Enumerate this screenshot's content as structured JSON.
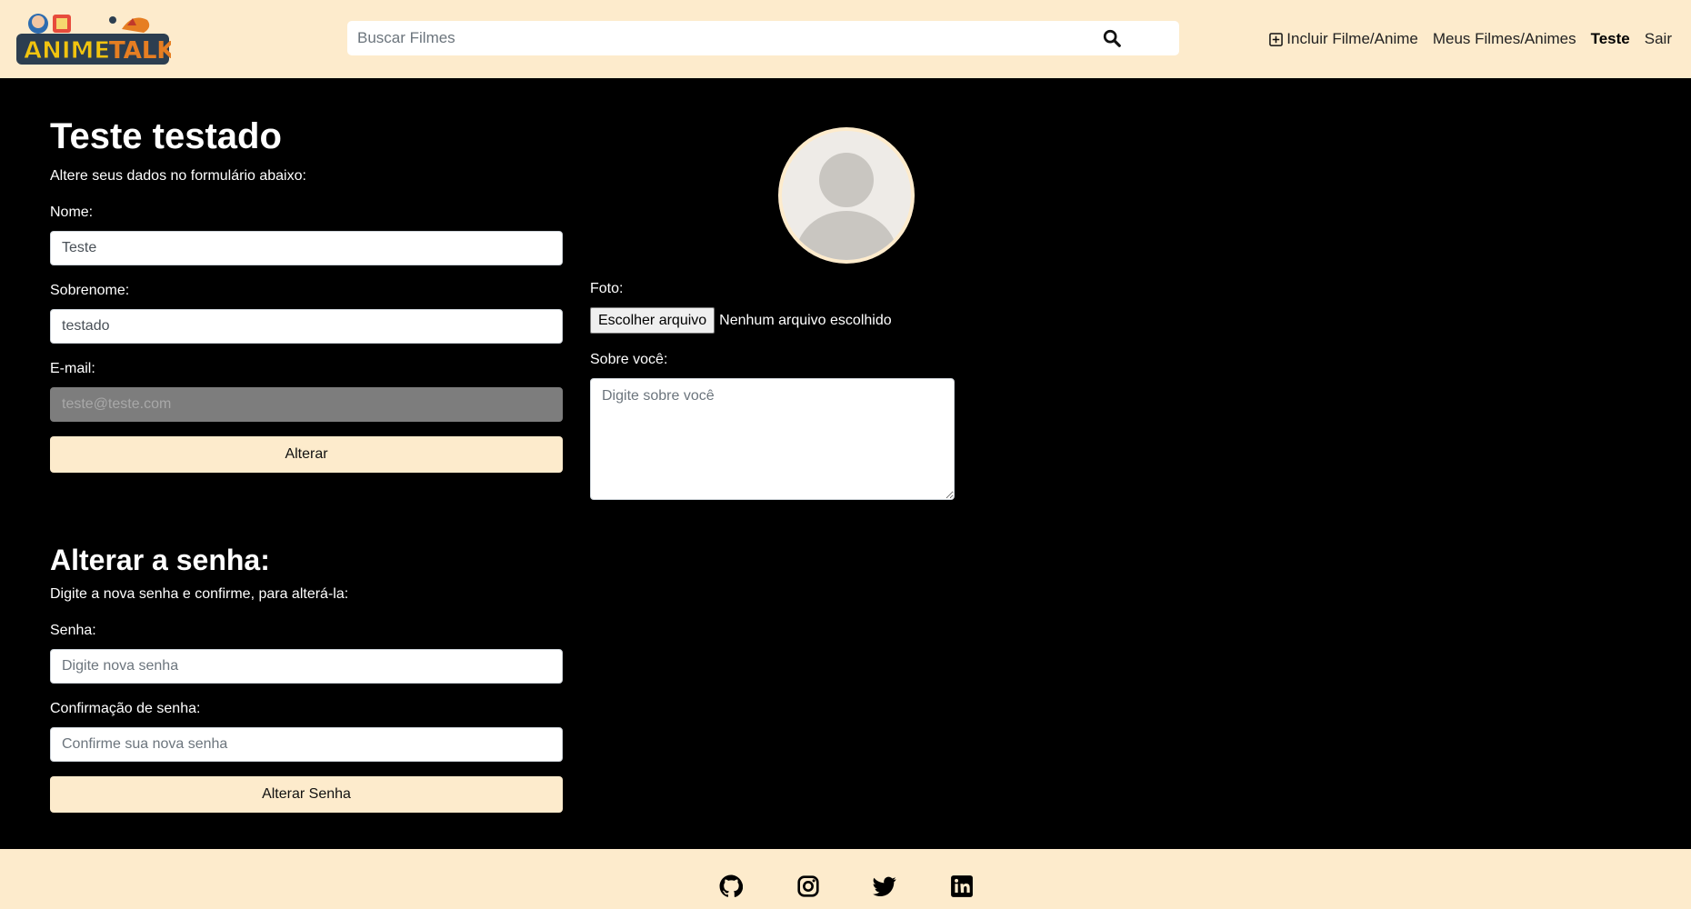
{
  "header": {
    "logo_text": "AnimeTalks",
    "search_placeholder": "Buscar Filmes",
    "nav": {
      "add": "Incluir Filme/Anime",
      "my_list": "Meus Filmes/Animes",
      "user": "Teste",
      "logout": "Sair"
    }
  },
  "profile": {
    "title": "Teste testado",
    "subtitle": "Altere seus dados no formulário abaixo:",
    "name_label": "Nome:",
    "name_value": "Teste",
    "surname_label": "Sobrenome:",
    "surname_value": "testado",
    "email_label": "E-mail:",
    "email_value": "teste@teste.com",
    "submit": "Alterar",
    "photo_label": "Foto:",
    "file_button": "Escolher arquivo",
    "file_status": "Nenhum arquivo escolhido",
    "about_label": "Sobre você:",
    "about_placeholder": "Digite sobre você"
  },
  "password": {
    "title": "Alterar a senha:",
    "subtitle": "Digite a nova senha e confirme, para alterá-la:",
    "password_label": "Senha:",
    "password_placeholder": "Digite nova senha",
    "confirm_label": "Confirmação de senha:",
    "confirm_placeholder": "Confirme sua nova senha",
    "submit": "Alterar Senha"
  },
  "footer": {
    "icons": [
      "github-icon",
      "instagram-icon",
      "twitter-icon",
      "linkedin-icon"
    ]
  },
  "colors": {
    "accent": "#fdebcc",
    "background": "#000000"
  }
}
